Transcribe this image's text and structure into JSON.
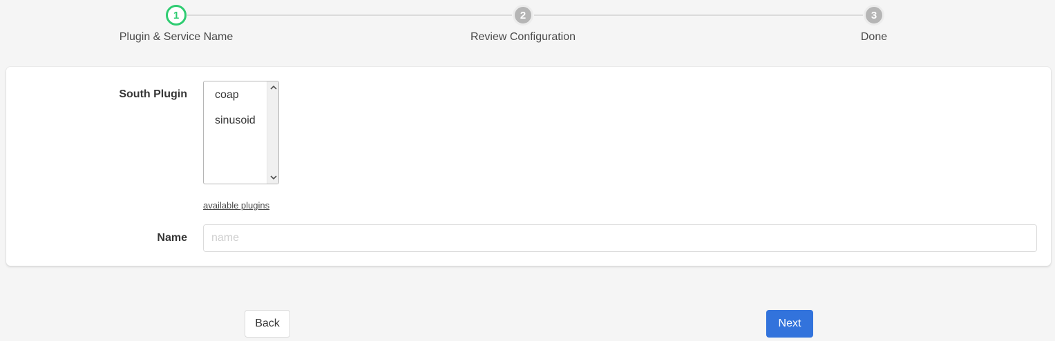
{
  "stepper": {
    "steps": [
      {
        "number": "1",
        "label": "Plugin & Service Name",
        "state": "active"
      },
      {
        "number": "2",
        "label": "Review Configuration",
        "state": "inactive"
      },
      {
        "number": "3",
        "label": "Done",
        "state": "inactive"
      }
    ]
  },
  "form": {
    "plugin_label": "South Plugin",
    "plugin_options": [
      "coap",
      "sinusoid"
    ],
    "available_plugins_link": "available plugins",
    "name_label": "Name",
    "name_value": "",
    "name_placeholder": "name"
  },
  "buttons": {
    "back": "Back",
    "next": "Next"
  },
  "colors": {
    "active_step": "#2ecc71",
    "inactive_step": "#b5b5b5",
    "primary_button": "#3273dc"
  },
  "icons": {
    "scroll_up": "chevron-up-icon",
    "scroll_down": "chevron-down-icon"
  }
}
